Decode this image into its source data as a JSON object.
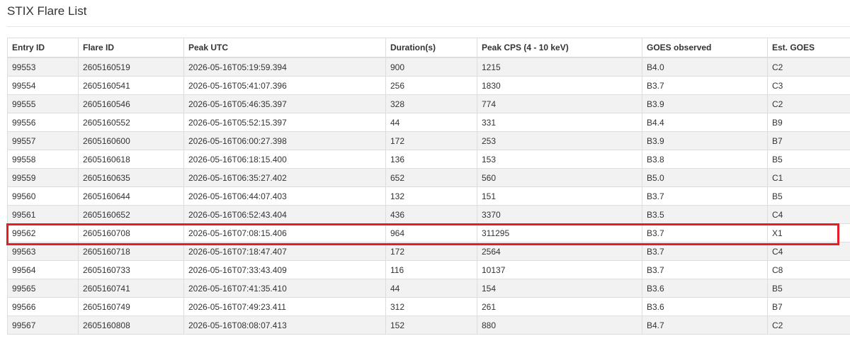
{
  "page": {
    "title": "STIX Flare List"
  },
  "table": {
    "columns": [
      "Entry ID",
      "Flare ID",
      "Peak UTC",
      "Duration(s)",
      "Peak CPS (4 - 10 keV)",
      "GOES observed",
      "Est. GOES"
    ],
    "rows": [
      [
        "99553",
        "2605160519",
        "2026-05-16T05:19:59.394",
        "900",
        "1215",
        "B4.0",
        "C2"
      ],
      [
        "99554",
        "2605160541",
        "2026-05-16T05:41:07.396",
        "256",
        "1830",
        "B3.7",
        "C3"
      ],
      [
        "99555",
        "2605160546",
        "2026-05-16T05:46:35.397",
        "328",
        "774",
        "B3.9",
        "C2"
      ],
      [
        "99556",
        "2605160552",
        "2026-05-16T05:52:15.397",
        "44",
        "331",
        "B4.4",
        "B9"
      ],
      [
        "99557",
        "2605160600",
        "2026-05-16T06:00:27.398",
        "172",
        "253",
        "B3.9",
        "B7"
      ],
      [
        "99558",
        "2605160618",
        "2026-05-16T06:18:15.400",
        "136",
        "153",
        "B3.8",
        "B5"
      ],
      [
        "99559",
        "2605160635",
        "2026-05-16T06:35:27.402",
        "652",
        "560",
        "B5.0",
        "C1"
      ],
      [
        "99560",
        "2605160644",
        "2026-05-16T06:44:07.403",
        "132",
        "151",
        "B3.7",
        "B5"
      ],
      [
        "99561",
        "2605160652",
        "2026-05-16T06:52:43.404",
        "436",
        "3370",
        "B3.5",
        "C4"
      ],
      [
        "99562",
        "2605160708",
        "2026-05-16T07:08:15.406",
        "964",
        "311295",
        "B3.7",
        "X1"
      ],
      [
        "99563",
        "2605160718",
        "2026-05-16T07:18:47.407",
        "172",
        "2564",
        "B3.7",
        "C4"
      ],
      [
        "99564",
        "2605160733",
        "2026-05-16T07:33:43.409",
        "116",
        "10137",
        "B3.7",
        "C8"
      ],
      [
        "99565",
        "2605160741",
        "2026-05-16T07:41:35.410",
        "44",
        "154",
        "B3.6",
        "B5"
      ],
      [
        "99566",
        "2605160749",
        "2026-05-16T07:49:23.411",
        "312",
        "261",
        "B3.6",
        "B7"
      ],
      [
        "99567",
        "2605160808",
        "2026-05-16T08:08:07.413",
        "152",
        "880",
        "B4.7",
        "C2"
      ]
    ],
    "highlighted_entry_id": "99562",
    "highlight_color": "#e21f26"
  }
}
